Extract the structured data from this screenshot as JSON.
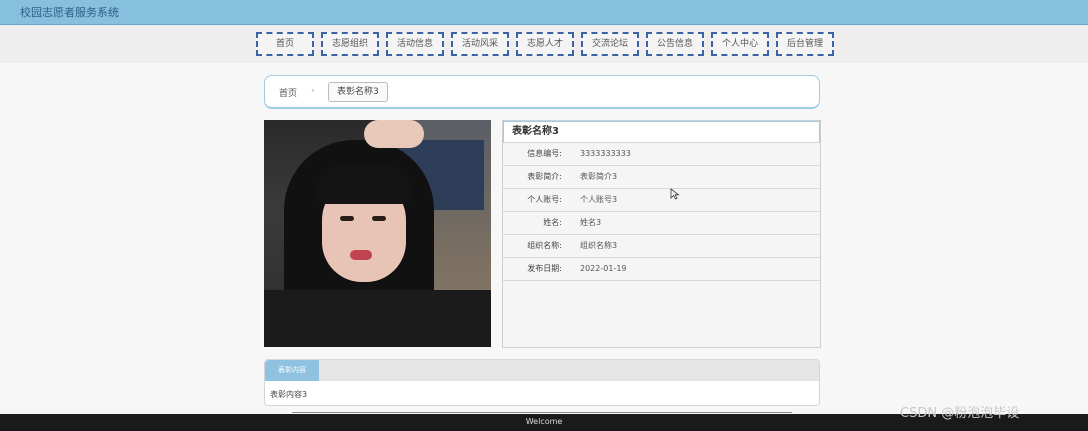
{
  "app": {
    "title": "校园志愿者服务系统"
  },
  "nav": {
    "items": [
      "首页",
      "志愿组织",
      "活动信息",
      "活动风采",
      "志愿人才",
      "交流论坛",
      "公告信息",
      "个人中心",
      "后台管理"
    ]
  },
  "breadcrumb": {
    "home": "首页",
    "separator": "›",
    "current": "表彰名称3"
  },
  "detail": {
    "title": "表彰名称3",
    "rows": [
      {
        "label": "信息编号:",
        "value": "3333333333"
      },
      {
        "label": "表彰简介:",
        "value": "表彰简介3"
      },
      {
        "label": "个人账号:",
        "value": "个人账号3"
      },
      {
        "label": "姓名:",
        "value": "姓名3"
      },
      {
        "label": "组织名称:",
        "value": "组织名称3"
      },
      {
        "label": "发布日期:",
        "value": "2022-01-19"
      }
    ]
  },
  "content": {
    "tab": "表彰内容",
    "text": "表彰内容3"
  },
  "footer": {
    "text": "Welcome"
  },
  "watermark": "CSDN @粉泡泡毕设",
  "colors": {
    "topbar": "#87bfdf",
    "nav_border": "#3a63a6",
    "accent_border": "#9ecbe6"
  }
}
